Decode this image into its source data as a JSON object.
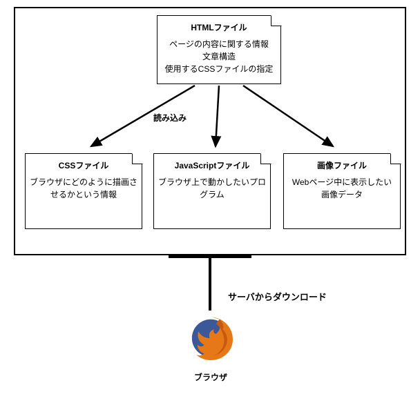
{
  "files": {
    "html": {
      "title": "HTMLファイル",
      "line1": "ページの内容に関する情報",
      "line2": "文章構造",
      "line3": "使用するCSSファイルの指定"
    },
    "css": {
      "title": "CSSファイル",
      "desc": "ブラウザにどのように描画させるかという情報"
    },
    "js": {
      "title": "JavaScriptファイル",
      "desc": "ブラウザ上で動かしたいプログラム"
    },
    "img": {
      "title": "画像ファイル",
      "desc": "Webページ中に表示したい画像データ"
    }
  },
  "labels": {
    "load": "読み込み",
    "download": "サーバからダウンロード",
    "browser": "ブラウザ"
  }
}
